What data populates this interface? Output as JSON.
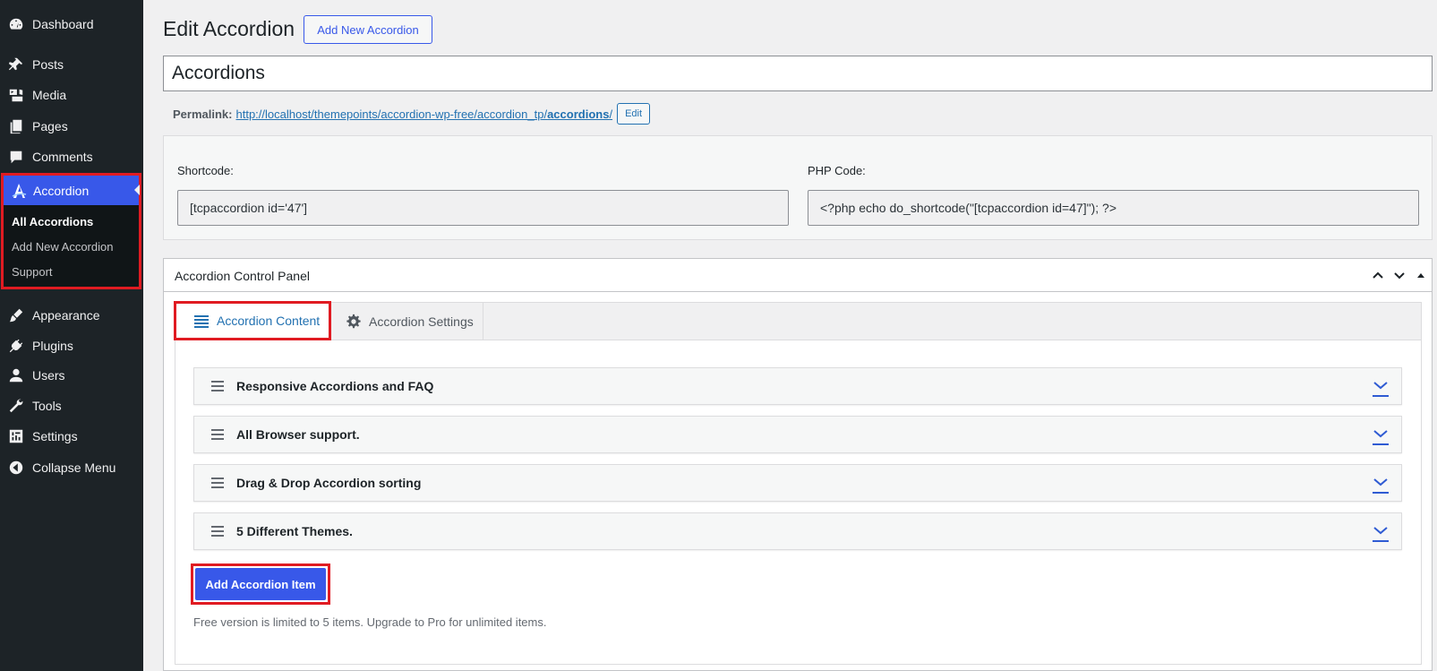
{
  "sidebar": {
    "items_top": [
      {
        "label": "Dashboard",
        "icon": "dashboard-icon"
      },
      {
        "label": "Posts",
        "icon": "pin-icon"
      },
      {
        "label": "Media",
        "icon": "media-icon"
      },
      {
        "label": "Pages",
        "icon": "pages-icon"
      },
      {
        "label": "Comments",
        "icon": "comment-icon"
      }
    ],
    "active": {
      "label": "Accordion",
      "icon": "accordion-logo-icon"
    },
    "submenu": [
      "All Accordions",
      "Add New Accordion",
      "Support"
    ],
    "items_bottom": [
      {
        "label": "Appearance",
        "icon": "brush-icon"
      },
      {
        "label": "Plugins",
        "icon": "plug-icon"
      },
      {
        "label": "Users",
        "icon": "user-icon"
      },
      {
        "label": "Tools",
        "icon": "wrench-icon"
      },
      {
        "label": "Settings",
        "icon": "settings-icon"
      },
      {
        "label": "Collapse Menu",
        "icon": "collapse-icon"
      }
    ]
  },
  "header": {
    "title": "Edit Accordion",
    "add_new": "Add New Accordion"
  },
  "post_title": "Accordions",
  "permalink": {
    "label": "Permalink:",
    "url_prefix": "http://localhost/themepoints/accordion-wp-free/accordion_tp/",
    "slug": "accordions",
    "url_suffix": "/",
    "edit": "Edit"
  },
  "shortcode": {
    "label": "Shortcode:",
    "value": "[tcpaccordion id='47']",
    "php_label": "PHP Code:",
    "php_value": "<?php echo do_shortcode(\"[tcpaccordion id=47]\"); ?>"
  },
  "panel": {
    "title": "Accordion Control Panel",
    "tabs": [
      "Accordion Content",
      "Accordion Settings"
    ],
    "items": [
      "Responsive Accordions and FAQ",
      "All Browser support.",
      "Drag & Drop Accordion sorting",
      "5 Different Themes."
    ],
    "add_button": "Add Accordion Item",
    "note": "Free version is limited to 5 items. Upgrade to Pro for unlimited items."
  },
  "colors": {
    "admin_bg": "#1d2327",
    "accent": "#3858e9",
    "highlight": "#e01b22",
    "link": "#2271b1"
  }
}
